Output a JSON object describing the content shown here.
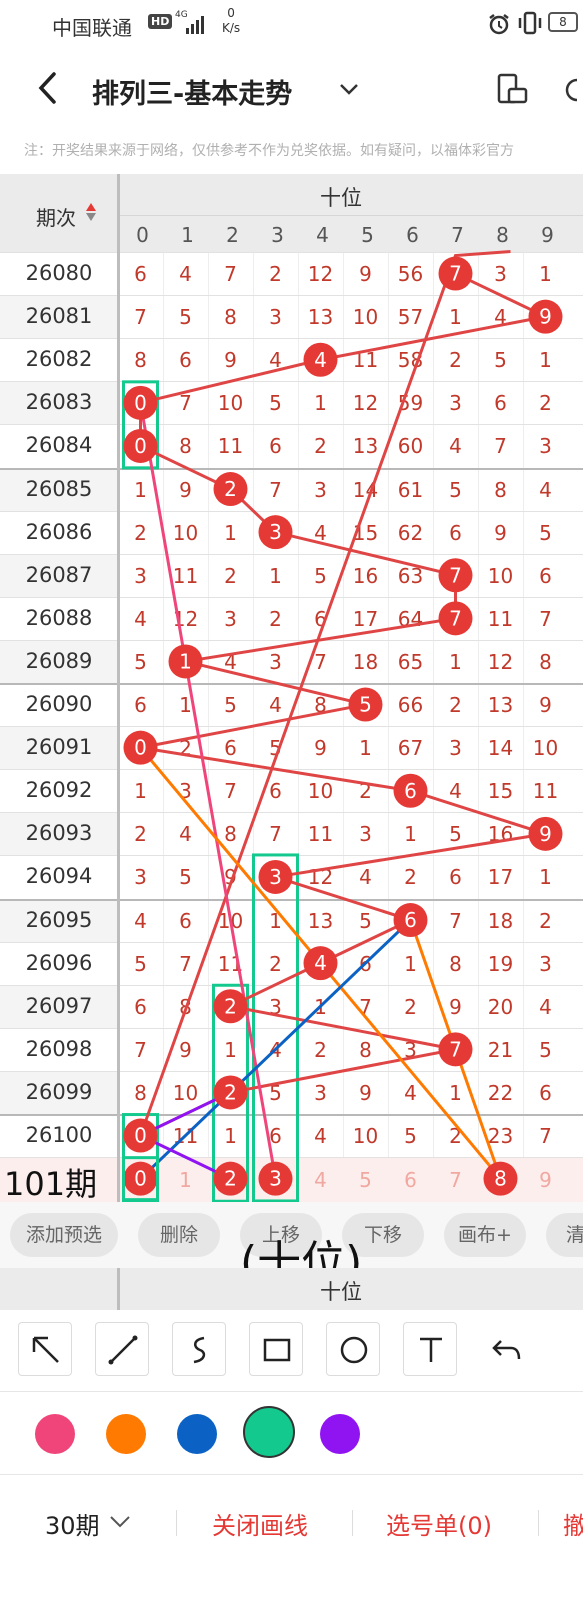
{
  "status_bar": {
    "carrier": "中国联通",
    "hd": "HD",
    "network": "4G",
    "speed_value": "0",
    "speed_unit": "K/s",
    "battery": "8"
  },
  "header": {
    "title": "排列三-基本走势"
  },
  "notice": "注：开奖结果来源于网络，仅供参考不作为兑奖依据。如有疑问，以福体彩官方",
  "chart": {
    "left_header": "期次",
    "top_header": "十位",
    "digits": [
      "0",
      "1",
      "2",
      "3",
      "4",
      "5",
      "6",
      "7",
      "8",
      "9"
    ],
    "rows": [
      {
        "issue": "26080",
        "cells": [
          "6",
          "4",
          "7",
          "2",
          "12",
          "9",
          "56",
          "7",
          "3",
          "1"
        ],
        "hit": 7
      },
      {
        "issue": "26081",
        "cells": [
          "7",
          "5",
          "8",
          "3",
          "13",
          "10",
          "57",
          "1",
          "4",
          "9"
        ],
        "hit": 9
      },
      {
        "issue": "26082",
        "cells": [
          "8",
          "6",
          "9",
          "4",
          "4",
          "11",
          "58",
          "2",
          "5",
          "1"
        ],
        "hit": 4
      },
      {
        "issue": "26083",
        "cells": [
          "0",
          "7",
          "10",
          "5",
          "1",
          "12",
          "59",
          "3",
          "6",
          "2"
        ],
        "hit": 0
      },
      {
        "issue": "26084",
        "cells": [
          "0",
          "8",
          "11",
          "6",
          "2",
          "13",
          "60",
          "4",
          "7",
          "3"
        ],
        "hit": 0
      },
      {
        "issue": "26085",
        "cells": [
          "1",
          "9",
          "2",
          "7",
          "3",
          "14",
          "61",
          "5",
          "8",
          "4"
        ],
        "hit": 2
      },
      {
        "issue": "26086",
        "cells": [
          "2",
          "10",
          "1",
          "3",
          "4",
          "15",
          "62",
          "6",
          "9",
          "5"
        ],
        "hit": 3
      },
      {
        "issue": "26087",
        "cells": [
          "3",
          "11",
          "2",
          "1",
          "5",
          "16",
          "63",
          "7",
          "10",
          "6"
        ],
        "hit": 7
      },
      {
        "issue": "26088",
        "cells": [
          "4",
          "12",
          "3",
          "2",
          "6",
          "17",
          "64",
          "7",
          "11",
          "7"
        ],
        "hit": 7
      },
      {
        "issue": "26089",
        "cells": [
          "5",
          "1",
          "4",
          "3",
          "7",
          "18",
          "65",
          "1",
          "12",
          "8"
        ],
        "hit": 1
      },
      {
        "issue": "26090",
        "cells": [
          "6",
          "1",
          "5",
          "4",
          "8",
          "5",
          "66",
          "2",
          "13",
          "9"
        ],
        "hit": 5
      },
      {
        "issue": "26091",
        "cells": [
          "0",
          "2",
          "6",
          "5",
          "9",
          "1",
          "67",
          "3",
          "14",
          "10"
        ],
        "hit": 0
      },
      {
        "issue": "26092",
        "cells": [
          "1",
          "3",
          "7",
          "6",
          "10",
          "2",
          "6",
          "4",
          "15",
          "11"
        ],
        "hit": 6
      },
      {
        "issue": "26093",
        "cells": [
          "2",
          "4",
          "8",
          "7",
          "11",
          "3",
          "1",
          "5",
          "16",
          "9"
        ],
        "hit": 9
      },
      {
        "issue": "26094",
        "cells": [
          "3",
          "5",
          "9",
          "3",
          "12",
          "4",
          "2",
          "6",
          "17",
          "1"
        ],
        "hit": 3
      },
      {
        "issue": "26095",
        "cells": [
          "4",
          "6",
          "10",
          "1",
          "13",
          "5",
          "6",
          "7",
          "18",
          "2"
        ],
        "hit": 6
      },
      {
        "issue": "26096",
        "cells": [
          "5",
          "7",
          "11",
          "2",
          "4",
          "6",
          "1",
          "8",
          "19",
          "3"
        ],
        "hit": 4
      },
      {
        "issue": "26097",
        "cells": [
          "6",
          "8",
          "2",
          "3",
          "1",
          "7",
          "2",
          "9",
          "20",
          "4"
        ],
        "hit": 2
      },
      {
        "issue": "26098",
        "cells": [
          "7",
          "9",
          "1",
          "4",
          "2",
          "8",
          "3",
          "7",
          "21",
          "5"
        ],
        "hit": 7
      },
      {
        "issue": "26099",
        "cells": [
          "8",
          "10",
          "2",
          "5",
          "3",
          "9",
          "4",
          "1",
          "22",
          "6"
        ],
        "hit": 2
      },
      {
        "issue": "26100",
        "cells": [
          "0",
          "11",
          "1",
          "6",
          "4",
          "10",
          "5",
          "2",
          "23",
          "7"
        ],
        "hit": 0
      }
    ],
    "preview": {
      "label": "101期",
      "cells": [
        "0",
        "1",
        "2",
        "3",
        "4",
        "5",
        "6",
        "7",
        "8",
        "9"
      ],
      "selected": [
        0,
        2,
        3,
        8
      ]
    },
    "ball_color": "#e53935",
    "trend_color": "#e04545"
  },
  "toolbar": {
    "add": "添加预选",
    "delete": "删除",
    "up": "上移",
    "down": "下移",
    "canvas": "画布+",
    "more": "清"
  },
  "overlay_label": "(十位)",
  "sub_header": "十位",
  "tools": [
    "arrow-tool",
    "line-tool",
    "freehand-tool",
    "rectangle-tool",
    "circle-tool",
    "text-tool",
    "undo-tool"
  ],
  "colors": {
    "pink": "#f0457a",
    "orange": "#ff7a00",
    "blue": "#0b62c4",
    "green": "#13c98e",
    "purple": "#9013f2"
  },
  "bottom": {
    "period": "30期",
    "close_lines": "关闭画线",
    "selection": "选号单(0)",
    "more": "撤"
  }
}
